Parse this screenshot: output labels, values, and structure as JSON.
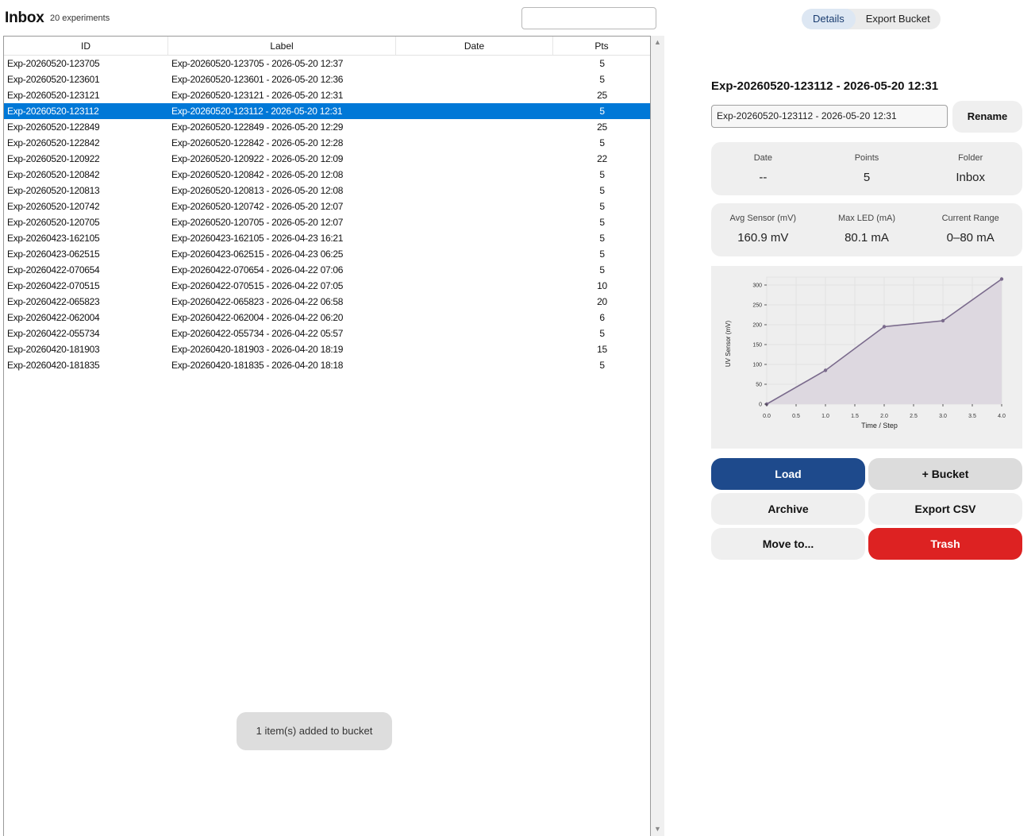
{
  "header": {
    "title": "Inbox",
    "count": "20 experiments",
    "search_placeholder": ""
  },
  "table": {
    "columns": [
      "ID",
      "Label",
      "Date",
      "Pts"
    ],
    "selected_index": 3,
    "rows": [
      {
        "id": "Exp-20260520-123705",
        "label": "Exp-20260520-123705 - 2026-05-20 12:37",
        "date": "",
        "pts": "5"
      },
      {
        "id": "Exp-20260520-123601",
        "label": "Exp-20260520-123601 - 2026-05-20 12:36",
        "date": "",
        "pts": "5"
      },
      {
        "id": "Exp-20260520-123121",
        "label": "Exp-20260520-123121 - 2026-05-20 12:31",
        "date": "",
        "pts": "25"
      },
      {
        "id": "Exp-20260520-123112",
        "label": "Exp-20260520-123112 - 2026-05-20 12:31",
        "date": "",
        "pts": "5"
      },
      {
        "id": "Exp-20260520-122849",
        "label": "Exp-20260520-122849 - 2026-05-20 12:29",
        "date": "",
        "pts": "25"
      },
      {
        "id": "Exp-20260520-122842",
        "label": "Exp-20260520-122842 - 2026-05-20 12:28",
        "date": "",
        "pts": "5"
      },
      {
        "id": "Exp-20260520-120922",
        "label": "Exp-20260520-120922 - 2026-05-20 12:09",
        "date": "",
        "pts": "22"
      },
      {
        "id": "Exp-20260520-120842",
        "label": "Exp-20260520-120842 - 2026-05-20 12:08",
        "date": "",
        "pts": "5"
      },
      {
        "id": "Exp-20260520-120813",
        "label": "Exp-20260520-120813 - 2026-05-20 12:08",
        "date": "",
        "pts": "5"
      },
      {
        "id": "Exp-20260520-120742",
        "label": "Exp-20260520-120742 - 2026-05-20 12:07",
        "date": "",
        "pts": "5"
      },
      {
        "id": "Exp-20260520-120705",
        "label": "Exp-20260520-120705 - 2026-05-20 12:07",
        "date": "",
        "pts": "5"
      },
      {
        "id": "Exp-20260423-162105",
        "label": "Exp-20260423-162105 - 2026-04-23 16:21",
        "date": "",
        "pts": "5"
      },
      {
        "id": "Exp-20260423-062515",
        "label": "Exp-20260423-062515 - 2026-04-23 06:25",
        "date": "",
        "pts": "5"
      },
      {
        "id": "Exp-20260422-070654",
        "label": "Exp-20260422-070654 - 2026-04-22 07:06",
        "date": "",
        "pts": "5"
      },
      {
        "id": "Exp-20260422-070515",
        "label": "Exp-20260422-070515 - 2026-04-22 07:05",
        "date": "",
        "pts": "10"
      },
      {
        "id": "Exp-20260422-065823",
        "label": "Exp-20260422-065823 - 2026-04-22 06:58",
        "date": "",
        "pts": "20"
      },
      {
        "id": "Exp-20260422-062004",
        "label": "Exp-20260422-062004 - 2026-04-22 06:20",
        "date": "",
        "pts": "6"
      },
      {
        "id": "Exp-20260422-055734",
        "label": "Exp-20260422-055734 - 2026-04-22 05:57",
        "date": "",
        "pts": "5"
      },
      {
        "id": "Exp-20260420-181903",
        "label": "Exp-20260420-181903 - 2026-04-20 18:19",
        "date": "",
        "pts": "15"
      },
      {
        "id": "Exp-20260420-181835",
        "label": "Exp-20260420-181835 - 2026-04-20 18:18",
        "date": "",
        "pts": "5"
      }
    ]
  },
  "toast": "1 item(s) added to bucket",
  "tabs": {
    "details": "Details",
    "export_bucket": "Export Bucket",
    "active": "details"
  },
  "detail": {
    "title": "Exp-20260520-123112 - 2026-05-20 12:31",
    "rename_value": "Exp-20260520-123112 - 2026-05-20 12:31",
    "rename_label": "Rename",
    "stats1": [
      {
        "label": "Date",
        "value": "--"
      },
      {
        "label": "Points",
        "value": "5"
      },
      {
        "label": "Folder",
        "value": "Inbox"
      }
    ],
    "stats2": [
      {
        "label": "Avg Sensor (mV)",
        "value": "160.9 mV"
      },
      {
        "label": "Max LED (mA)",
        "value": "80.1 mA"
      },
      {
        "label": "Current Range",
        "value": "0–80 mA"
      }
    ]
  },
  "chart_data": {
    "type": "area",
    "x": [
      0,
      1,
      2,
      3,
      4
    ],
    "values": [
      0,
      85,
      195,
      210,
      315
    ],
    "xlabel": "Time / Step",
    "ylabel": "UV Sensor (mV)",
    "xlim": [
      0,
      4
    ],
    "ylim": [
      0,
      320
    ],
    "xticks": [
      "0.0",
      "0.5",
      "1.0",
      "1.5",
      "2.0",
      "2.5",
      "3.0",
      "3.5",
      "4.0"
    ],
    "xtick_values": [
      0,
      0.5,
      1,
      1.5,
      2,
      2.5,
      3,
      3.5,
      4
    ],
    "yticks": [
      "0",
      "50",
      "100",
      "150",
      "200",
      "250",
      "300"
    ],
    "ytick_values": [
      0,
      50,
      100,
      150,
      200,
      250,
      300
    ],
    "grid": true,
    "line_color": "#7a6a8c",
    "fill_color": "#ddd8e0"
  },
  "actions": {
    "load": "Load",
    "bucket": "+ Bucket",
    "archive": "Archive",
    "export_csv": "Export CSV",
    "move": "Move to...",
    "trash": "Trash"
  },
  "colors": {
    "accent": "#1e4a8c",
    "selection": "#0078d7",
    "danger": "#dd2222"
  }
}
